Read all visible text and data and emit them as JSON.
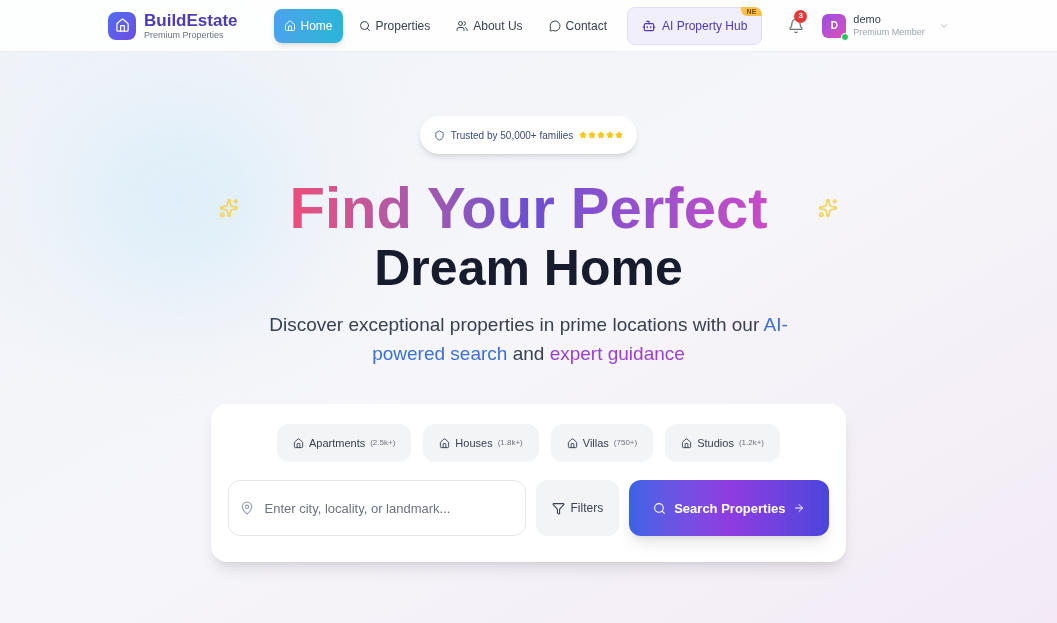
{
  "brand": {
    "name": "BuildEstate",
    "tagline": "Premium Properties"
  },
  "nav": [
    {
      "label": "Home",
      "selected": true
    },
    {
      "label": "Properties",
      "selected": false
    },
    {
      "label": "About Us",
      "selected": false
    },
    {
      "label": "Contact",
      "selected": false
    }
  ],
  "ai_hub": {
    "label": "AI Property Hub",
    "badge": "NE"
  },
  "notifications": {
    "count": "3"
  },
  "user": {
    "initial": "D",
    "name": "demo",
    "role": "Premium Member",
    "online": true
  },
  "trust_badge": {
    "text": "Trusted by 50,000+ families",
    "stars": 5
  },
  "headline": {
    "line_1": "Find Your Perfect",
    "line_2": "Dream Home"
  },
  "subtitle": [
    {
      "kind": "plain",
      "text": "Discover exceptional properties in prime locations with our "
    },
    {
      "kind": "blue",
      "text": "AI-powered search"
    },
    {
      "kind": "plain",
      "text": " and "
    },
    {
      "kind": "purple",
      "text": "expert guidance"
    }
  ],
  "categories": [
    {
      "label": "Apartments",
      "count": "(2.5k+)"
    },
    {
      "label": "Houses",
      "count": "(1.8k+)"
    },
    {
      "label": "Villas",
      "count": "(750+)"
    },
    {
      "label": "Studios",
      "count": "(1.2k+)"
    }
  ],
  "search": {
    "placeholder": "Enter city, locality, or landmark...",
    "filters": "Filters",
    "button": "Search Properties"
  }
}
